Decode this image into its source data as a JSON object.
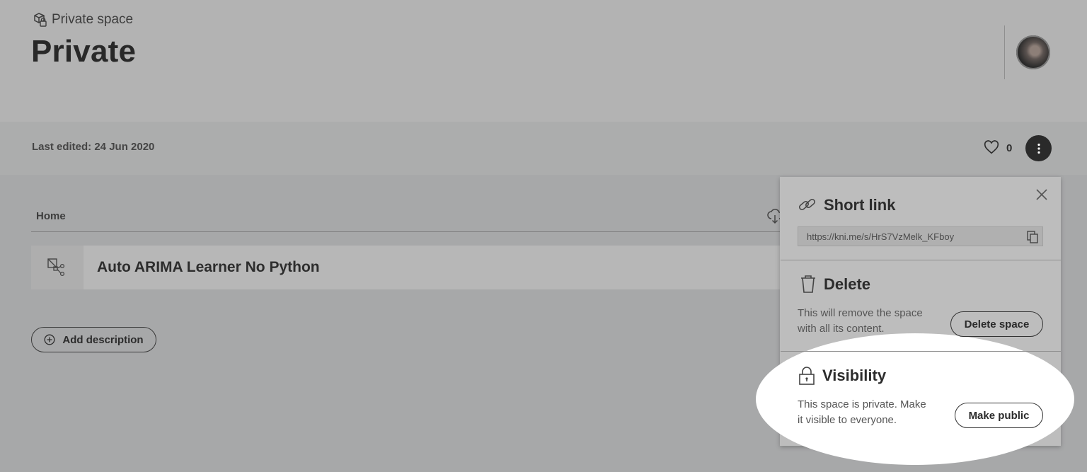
{
  "breadcrumb": {
    "label": "Private space",
    "icon": "private-space-icon"
  },
  "page": {
    "title": "Private"
  },
  "meta": {
    "last_edited": "Last edited: 24 Jun 2020",
    "likes": "0"
  },
  "content": {
    "home_label": "Home",
    "items": [
      {
        "name": "Auto ARIMA Learner No Python",
        "icon": "workflow-icon"
      }
    ],
    "add_description": "Add description"
  },
  "popup": {
    "short_link": {
      "title": "Short link",
      "url": "https://kni.me/s/HrS7VzMelk_KFboy"
    },
    "delete": {
      "title": "Delete",
      "desc_line1": "This will remove the space",
      "desc_line2": "with all its content.",
      "button": "Delete space"
    },
    "visibility": {
      "title": "Visibility",
      "desc_line1": "This space is private. Make",
      "desc_line2": "it visible to everyone.",
      "button": "Make public"
    }
  },
  "colors": {
    "overlay": "#a7a8a9",
    "dark": "#2a2a2a",
    "highlight": "#ffffff"
  }
}
